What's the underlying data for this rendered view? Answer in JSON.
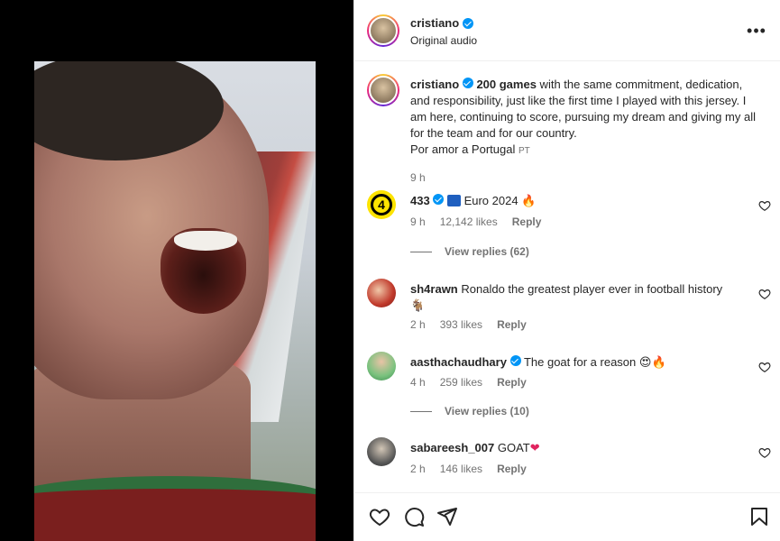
{
  "post": {
    "username": "cristiano",
    "audio": "Original audio",
    "more_icon": "more-horizontal-icon"
  },
  "caption": {
    "username": "cristiano",
    "bold_text": "200 games",
    "text": " with the same commitment, dedication, and responsibility, just like the first time I played with this jersey. I am here, continuing to score, pursuing my dream and giving my all for the team and for our country.",
    "text2": "Por amor a Portugal",
    "flag": "PT",
    "time": "9 h"
  },
  "comments": [
    {
      "username": "433",
      "text": "Euro 2024",
      "emoji": "🔥",
      "time": "9 h",
      "likes": "12,142 likes",
      "reply": "Reply",
      "view_replies": "View replies (62)"
    },
    {
      "username": "sh4rawn",
      "text": "Ronaldo the greatest player ever in football history",
      "emoji": "🐐",
      "time": "2 h",
      "likes": "393 likes",
      "reply": "Reply"
    },
    {
      "username": "aasthachaudhary",
      "text": "The goat for a reason",
      "emoji": "😍🔥",
      "time": "4 h",
      "likes": "259 likes",
      "reply": "Reply",
      "view_replies": "View replies (10)"
    },
    {
      "username": "sabareesh_007",
      "text": "GOAT",
      "emoji": "❤",
      "time": "2 h",
      "likes": "146 likes",
      "reply": "Reply"
    }
  ],
  "actions": {
    "like_icon": "heart-icon",
    "comment_icon": "comment-icon",
    "share_icon": "send-icon",
    "save_icon": "bookmark-icon"
  },
  "colors": {
    "verified": "#0095f6",
    "muted": "#737373",
    "text": "#262626"
  }
}
